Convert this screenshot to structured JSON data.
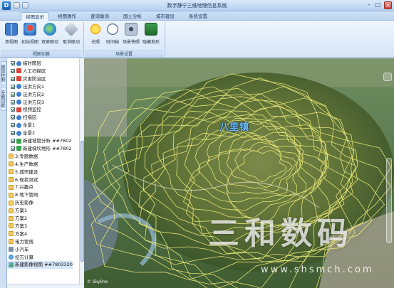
{
  "window": {
    "title": "数字静宁三维地理信息系统",
    "_title_note": "title text is small and blurry — characters partly uncertain"
  },
  "tabs": [
    {
      "label": "视图显示",
      "active": true
    },
    {
      "label": "视图操作",
      "active": false
    },
    {
      "label": "查询量测",
      "active": false
    },
    {
      "label": "国土分析",
      "active": false
    },
    {
      "label": "城市建设",
      "active": false
    },
    {
      "label": "系统设置",
      "active": false
    }
  ],
  "ribbon": {
    "view_group": {
      "label": "视图切换",
      "buttons": [
        {
          "label": "双视图",
          "icon": "dual-view-icon"
        },
        {
          "label": "初始视图",
          "icon": "initial-view-icon"
        },
        {
          "label": "双屏联动",
          "icon": "dual-screen-icon"
        },
        {
          "label": "取消联动",
          "icon": "cancel-link-icon"
        }
      ]
    },
    "scene_group": {
      "label": "场景设置",
      "buttons": [
        {
          "label": "光照",
          "icon": "sun-icon"
        },
        {
          "label": "时间轴",
          "icon": "clock-icon"
        },
        {
          "label": "场景快照",
          "icon": "camera-icon"
        },
        {
          "label": "隐藏地形",
          "icon": "terrain-icon"
        }
      ]
    }
  },
  "side_tabs": [
    "图层控制",
    "专题功能"
  ],
  "layer_tree": [
    {
      "label": "临时图层",
      "checked": true,
      "icon": "layer",
      "indent": 1
    },
    {
      "label": "人工扫描区",
      "checked": true,
      "icon": "red",
      "indent": 1
    },
    {
      "label": "灾害防治区",
      "checked": true,
      "icon": "red",
      "indent": 1
    },
    {
      "label": "泛洪方向1",
      "checked": true,
      "icon": "layer",
      "indent": 1
    },
    {
      "label": "泛洪方向2",
      "checked": true,
      "icon": "layer",
      "indent": 1
    },
    {
      "label": "泛洪方向3",
      "checked": true,
      "icon": "layer",
      "indent": 1
    },
    {
      "label": "视频监控",
      "checked": true,
      "icon": "red",
      "indent": 1
    },
    {
      "label": "扫描区",
      "checked": true,
      "icon": "layer",
      "indent": 1
    },
    {
      "label": "全景1",
      "checked": true,
      "icon": "layer",
      "indent": 1
    },
    {
      "label": "全景2",
      "checked": true,
      "icon": "layer",
      "indent": 1
    },
    {
      "label": "新建坡度分析 ##7802",
      "checked": true,
      "icon": "green",
      "indent": 1
    },
    {
      "label": "新建梯坎地形 ##7802",
      "checked": true,
      "icon": "green",
      "indent": 1
    },
    {
      "label": "3.专题数据",
      "checked": false,
      "icon": "folder",
      "indent": 0
    },
    {
      "label": "4.生产数据",
      "checked": false,
      "icon": "folder",
      "indent": 0
    },
    {
      "label": "5.城市建设",
      "checked": false,
      "icon": "folder",
      "indent": 0
    },
    {
      "label": "6.现状测试",
      "checked": false,
      "icon": "folder",
      "indent": 0
    },
    {
      "label": "7.兴趣点",
      "checked": false,
      "icon": "folder",
      "indent": 0
    },
    {
      "label": "8.地下管网",
      "checked": false,
      "icon": "folder",
      "indent": 0
    },
    {
      "label": "历史影像",
      "checked": false,
      "icon": "folder",
      "indent": 0
    },
    {
      "label": "方案1",
      "checked": false,
      "icon": "folder",
      "indent": 0
    },
    {
      "label": "方案2",
      "checked": false,
      "icon": "folder",
      "indent": 0
    },
    {
      "label": "方案3",
      "checked": false,
      "icon": "folder",
      "indent": 0
    },
    {
      "label": "方案4",
      "checked": false,
      "icon": "folder",
      "indent": 0
    },
    {
      "label": "电力管线",
      "checked": false,
      "icon": "folder",
      "indent": 0
    },
    {
      "label": "小汽车",
      "checked": false,
      "icon": "car",
      "indent": 0
    },
    {
      "label": "挖方计算",
      "checked": false,
      "icon": "dl",
      "indent": 0
    },
    {
      "label": "新建影像视图 ##7803320",
      "checked": false,
      "icon": "img",
      "indent": 0
    }
  ],
  "map": {
    "place_label": "八里镇",
    "attribution": "© Skyline"
  },
  "watermark": {
    "text": "三和数码",
    "url": "www.shsmch.com"
  }
}
